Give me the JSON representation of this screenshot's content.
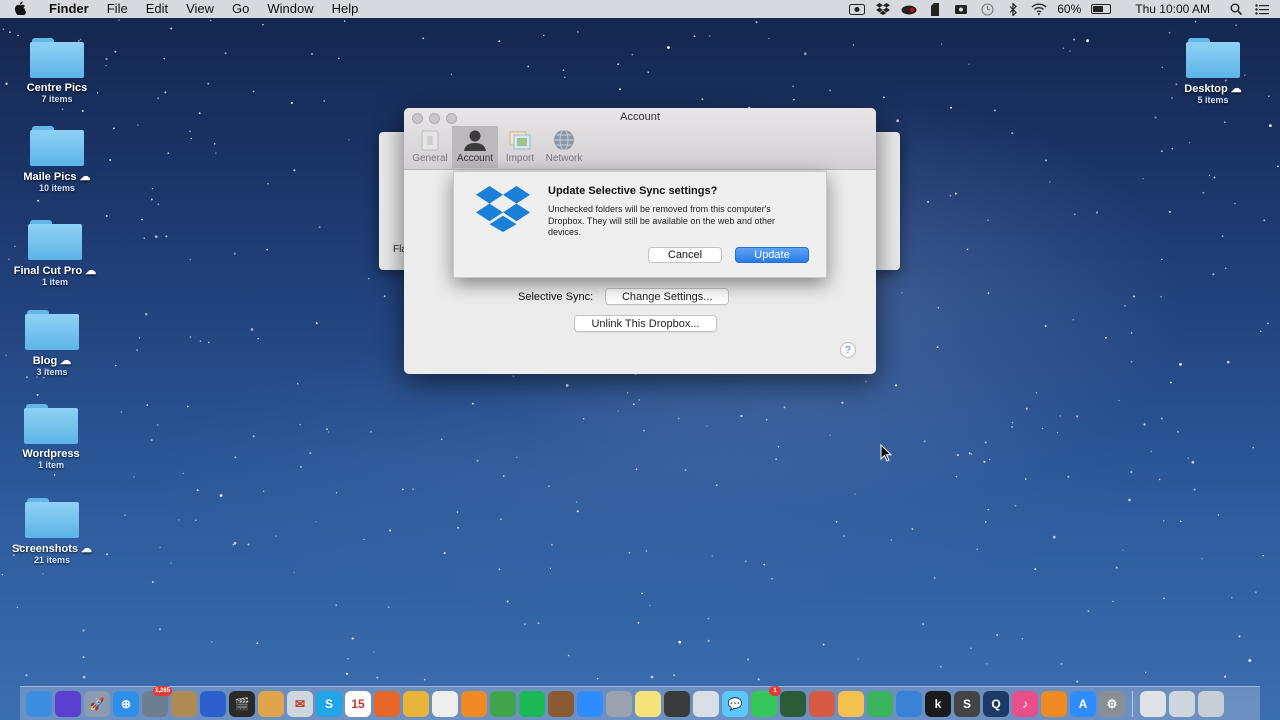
{
  "menubar": {
    "app_name": "Finder",
    "menus": [
      "File",
      "Edit",
      "View",
      "Go",
      "Window",
      "Help"
    ],
    "battery_percent": "60%",
    "battery_level": 0.6,
    "clock": "Thu 10:00 AM"
  },
  "desktop": {
    "icons_left": [
      {
        "name": "Centre Pics",
        "count": "7 items",
        "cloud": false
      },
      {
        "name": "Maile Pics",
        "count": "10 items",
        "cloud": true
      },
      {
        "name": "Final Cut Pro",
        "count": "1 item",
        "cloud": true
      },
      {
        "name": "Blog",
        "count": "3 items",
        "cloud": true
      },
      {
        "name": "Wordpress",
        "count": "1 item",
        "cloud": false
      },
      {
        "name": "Screenshots",
        "count": "21 items",
        "cloud": true
      }
    ],
    "icon_right": {
      "name": "Desktop",
      "count": "5 items",
      "cloud": true
    }
  },
  "background_window": {
    "partial_label": "Fla"
  },
  "prefs_window": {
    "title": "Account",
    "toolbar": [
      {
        "label": "General",
        "icon": "general-icon"
      },
      {
        "label": "Account",
        "icon": "account-icon",
        "active": true
      },
      {
        "label": "Import",
        "icon": "import-icon"
      },
      {
        "label": "Network",
        "icon": "network-icon"
      }
    ],
    "selective_sync_label": "Selective Sync:",
    "change_settings_button": "Change Settings...",
    "unlink_button": "Unlink This Dropbox...",
    "help_label": "?"
  },
  "sheet": {
    "title": "Update Selective Sync settings?",
    "message": "Unchecked folders will be removed from this computer's Dropbox. They will still be available on the web and other devices.",
    "cancel_label": "Cancel",
    "update_label": "Update"
  },
  "dock": {
    "apps": [
      {
        "name": "finder",
        "color": "#3d8de0",
        "glyph": ""
      },
      {
        "name": "siri",
        "color": "#5a3fd0",
        "glyph": ""
      },
      {
        "name": "launchpad",
        "color": "#8a9bb2",
        "glyph": "🚀"
      },
      {
        "name": "safari",
        "color": "#2f8fe8",
        "glyph": "⊕"
      },
      {
        "name": "photo-app",
        "color": "#6d7e90",
        "glyph": "",
        "badge": "1,265"
      },
      {
        "name": "notebook",
        "color": "#b08a55",
        "glyph": ""
      },
      {
        "name": "photos-blue",
        "color": "#2d5fcf",
        "glyph": ""
      },
      {
        "name": "clapper",
        "color": "#2a2a2a",
        "glyph": "🎬"
      },
      {
        "name": "color-app",
        "color": "#e0a44a",
        "glyph": ""
      },
      {
        "name": "mail",
        "color": "#d0d6df",
        "glyph": "✉"
      },
      {
        "name": "skype",
        "color": "#1fa5e8",
        "glyph": "S"
      },
      {
        "name": "calendar",
        "color": "#ffffff",
        "glyph": "15"
      },
      {
        "name": "firefox",
        "color": "#e6662a",
        "glyph": ""
      },
      {
        "name": "chrome",
        "color": "#e9b43a",
        "glyph": ""
      },
      {
        "name": "textedit",
        "color": "#eeeeee",
        "glyph": ""
      },
      {
        "name": "pages",
        "color": "#f08a24",
        "glyph": ""
      },
      {
        "name": "evernote",
        "color": "#3fa44b",
        "glyph": ""
      },
      {
        "name": "spotify",
        "color": "#1db954",
        "glyph": ""
      },
      {
        "name": "guitar",
        "color": "#8a5a35",
        "glyph": ""
      },
      {
        "name": "zoom",
        "color": "#2d8cff",
        "glyph": ""
      },
      {
        "name": "utility",
        "color": "#9aa3ad",
        "glyph": ""
      },
      {
        "name": "notes",
        "color": "#f6e27a",
        "glyph": ""
      },
      {
        "name": "photo-booth",
        "color": "#3a3a3a",
        "glyph": ""
      },
      {
        "name": "preview",
        "color": "#d8dee6",
        "glyph": ""
      },
      {
        "name": "messages",
        "color": "#5ac8fa",
        "glyph": "💬"
      },
      {
        "name": "facetime",
        "color": "#34c759",
        "glyph": "",
        "badge": "1"
      },
      {
        "name": "camera-app",
        "color": "#2b5c3a",
        "glyph": ""
      },
      {
        "name": "photo-editor",
        "color": "#d65a46",
        "glyph": ""
      },
      {
        "name": "photos",
        "color": "#f2c14e",
        "glyph": ""
      },
      {
        "name": "numbers",
        "color": "#3bb35b",
        "glyph": ""
      },
      {
        "name": "keynote",
        "color": "#3a82d8",
        "glyph": ""
      },
      {
        "name": "kindle",
        "color": "#1a1a1a",
        "glyph": "k"
      },
      {
        "name": "sonos",
        "color": "#444444",
        "glyph": "S"
      },
      {
        "name": "quicktime",
        "color": "#1c3a66",
        "glyph": "Q"
      },
      {
        "name": "itunes",
        "color": "#e94e8a",
        "glyph": "♪"
      },
      {
        "name": "ibooks",
        "color": "#f08a24",
        "glyph": ""
      },
      {
        "name": "app-store",
        "color": "#2d8cff",
        "glyph": "A"
      },
      {
        "name": "system-preferences",
        "color": "#8a8f96",
        "glyph": "⚙"
      }
    ],
    "right_items": [
      {
        "name": "document-stack",
        "color": "#dfe3e8"
      },
      {
        "name": "downloads-stack",
        "color": "#cfd6de"
      },
      {
        "name": "trash",
        "color": "#c8ced6"
      }
    ]
  }
}
